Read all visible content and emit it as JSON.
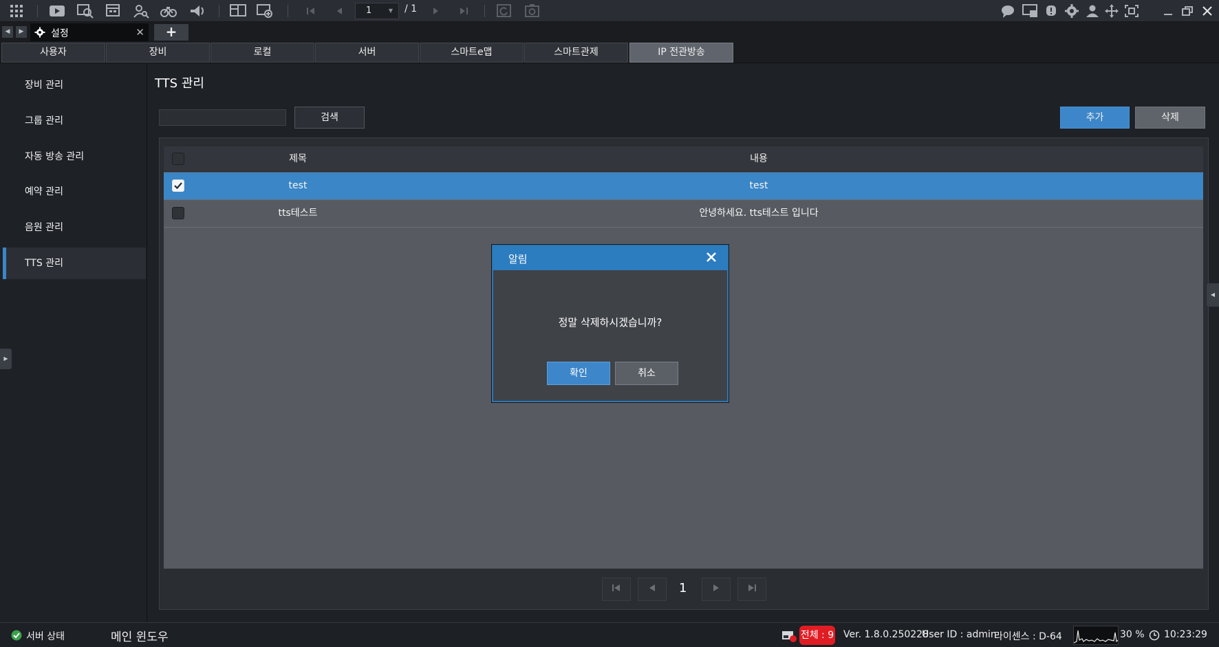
{
  "toolbar": {
    "icons": [
      "grid-menu-icon",
      "play-icon",
      "search-playback-icon",
      "event-list-icon",
      "person-search-icon",
      "bicycle-icon",
      "broadcast-icon",
      "layout-icon",
      "add-window-icon",
      "first-page-icon",
      "prev-page-icon",
      "next-page-icon",
      "last-page-icon",
      "refresh-icon",
      "capture-icon"
    ],
    "page_current": "1",
    "page_total": "/ 1",
    "right_icons": [
      "chat-icon",
      "monitor-alert-icon",
      "alarm-icon",
      "settings-icon",
      "user-icon",
      "move-icon",
      "fullscreen-icon",
      "minimize-icon",
      "restore-icon",
      "close-icon"
    ]
  },
  "tabstrip": {
    "doc_tab_label": "설정",
    "add_tab_label": "+"
  },
  "main_tabs": [
    {
      "label": "사용자"
    },
    {
      "label": "장비"
    },
    {
      "label": "로컬"
    },
    {
      "label": "서버"
    },
    {
      "label": "스마트e맵"
    },
    {
      "label": "스마트관제"
    },
    {
      "label": "IP 전관방송",
      "active": true
    }
  ],
  "sidebar": {
    "items": [
      {
        "label": "장비 관리"
      },
      {
        "label": "그룹 관리"
      },
      {
        "label": "자동 방송 관리"
      },
      {
        "label": "예약 관리"
      },
      {
        "label": "음원 관리"
      },
      {
        "label": "TTS 관리",
        "active": true
      }
    ]
  },
  "content": {
    "title": "TTS 관리",
    "search_value": "",
    "search_button": "검색",
    "add_button": "추가",
    "delete_button": "삭제",
    "table": {
      "columns": [
        "제목",
        "내용"
      ],
      "rows": [
        {
          "title": "test",
          "content": "test",
          "checked": true,
          "selected": true
        },
        {
          "title": "tts테스트",
          "content": "안녕하세요. tts테스트 입니다",
          "checked": false,
          "selected": false
        }
      ]
    },
    "pagination": {
      "current": "1"
    }
  },
  "dialog": {
    "title": "알림",
    "message": "정말 삭제하시겠습니까?",
    "ok_label": "확인",
    "cancel_label": "취소"
  },
  "statusbar": {
    "server_status": "서버 상태",
    "main_window": "메인 윈도우",
    "total_badge": "전체 : 9",
    "version": "Ver. 1.8.0.250228",
    "user_id": "User ID : admin",
    "license": "라이센스 : D-64",
    "cpu_percent": "30 %",
    "clock": "10:23:29"
  },
  "colors": {
    "accent": "#3a86c8",
    "selected_row": "#3a86c6",
    "badge": "#e11d24"
  }
}
